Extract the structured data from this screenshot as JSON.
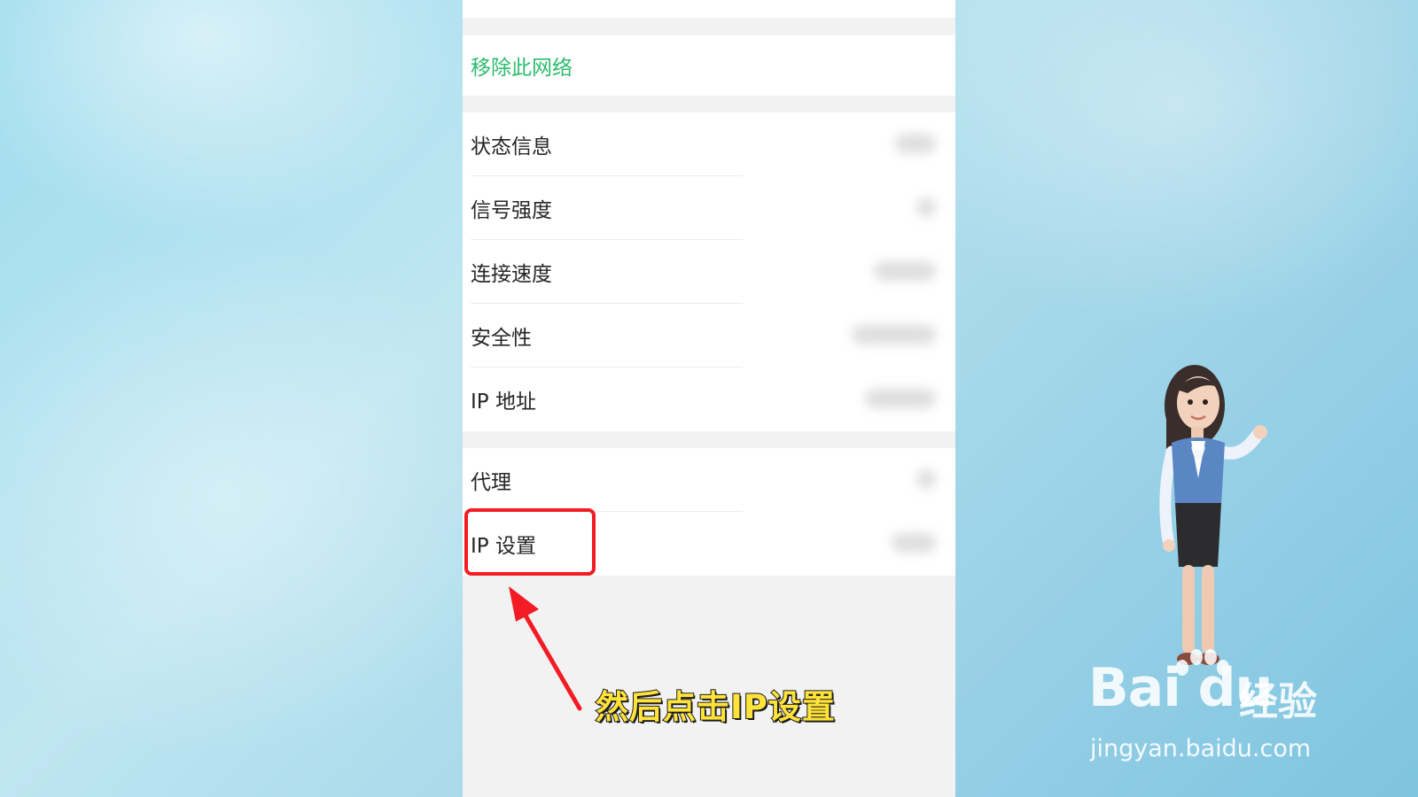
{
  "settings": {
    "remove_network": "移除此网络",
    "group1": [
      {
        "label": "状态信息"
      },
      {
        "label": "信号强度"
      },
      {
        "label": "连接速度"
      },
      {
        "label": "安全性"
      },
      {
        "label": "IP 地址"
      }
    ],
    "group2": [
      {
        "label": "代理"
      },
      {
        "label": "IP 设置"
      }
    ]
  },
  "annotation": {
    "caption": "然后点击IP设置",
    "highlight_color": "#f41c24",
    "caption_color": "#ffe23a"
  },
  "watermark": {
    "logo": "Bai du",
    "logo_suffix": "经验",
    "url": "jingyan.baidu.com"
  },
  "colors": {
    "accent_green": "#2dbd6e",
    "background": "#a6d8ea"
  }
}
